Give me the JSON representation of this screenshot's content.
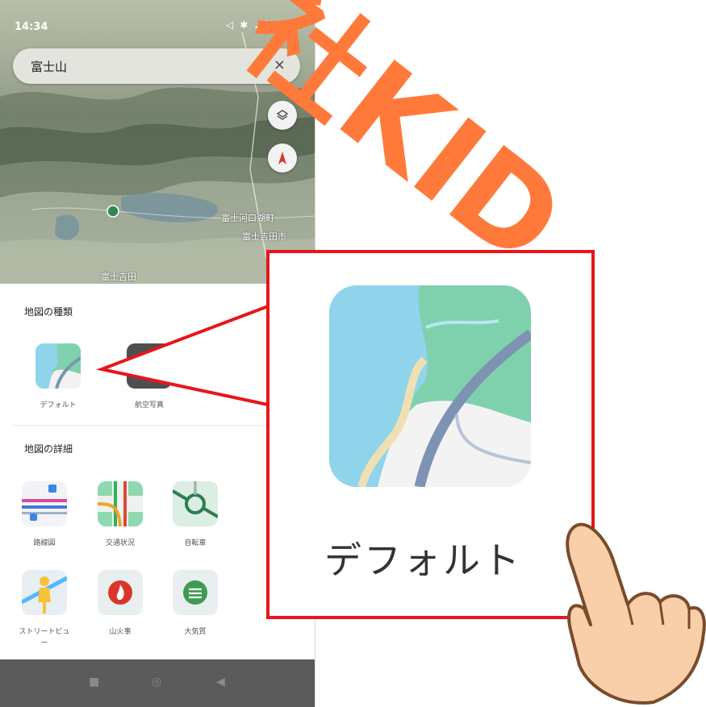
{
  "status_bar": {
    "time": "14:34",
    "icons": "◁ ✱ .ıl ≋ ▭"
  },
  "search": {
    "query": "富士山",
    "close_symbol": "×"
  },
  "map": {
    "labels": [
      "富士吉田",
      "富士河口湖町",
      "富士吉田市"
    ]
  },
  "sheet": {
    "map_type_title": "地図の種類",
    "map_types": [
      {
        "label": "デフォルト",
        "icon": "default-map-icon"
      },
      {
        "label": "航空写真",
        "icon": "satellite-map-icon"
      }
    ],
    "details_title": "地図の詳細",
    "details": [
      {
        "label": "路線図",
        "icon": "transit-icon"
      },
      {
        "label": "交通状況",
        "icon": "traffic-icon"
      },
      {
        "label": "自転車",
        "icon": "bicycle-icon"
      },
      {
        "label": "ストリートビュー",
        "icon": "street-view-icon"
      },
      {
        "label": "山火事",
        "icon": "wildfire-icon"
      },
      {
        "label": "大気質",
        "icon": "air-quality-icon"
      }
    ]
  },
  "navbar": {
    "square": "■",
    "home": "◎",
    "back": "◀"
  },
  "callout": {
    "label": "デフォルト"
  },
  "watermark": {
    "text": "社KID"
  },
  "colors": {
    "callout_border": "#e8151b",
    "watermark": "#ff7a3a",
    "hand": "#f9cfa9"
  }
}
